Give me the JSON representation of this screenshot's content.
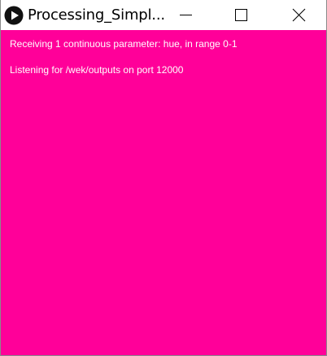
{
  "window": {
    "title": "Processing_Simpl...",
    "app_icon": "processing-play-icon",
    "controls": {
      "minimize_icon": "minimize-icon",
      "maximize_icon": "maximize-icon",
      "close_icon": "close-icon"
    }
  },
  "sketch": {
    "background_color": "#ff0099",
    "text_color": "#ffffff",
    "lines": [
      "Receiving 1 continuous parameter: hue, in range 0-1",
      "Listening for /wek/outputs on port 12000"
    ]
  }
}
